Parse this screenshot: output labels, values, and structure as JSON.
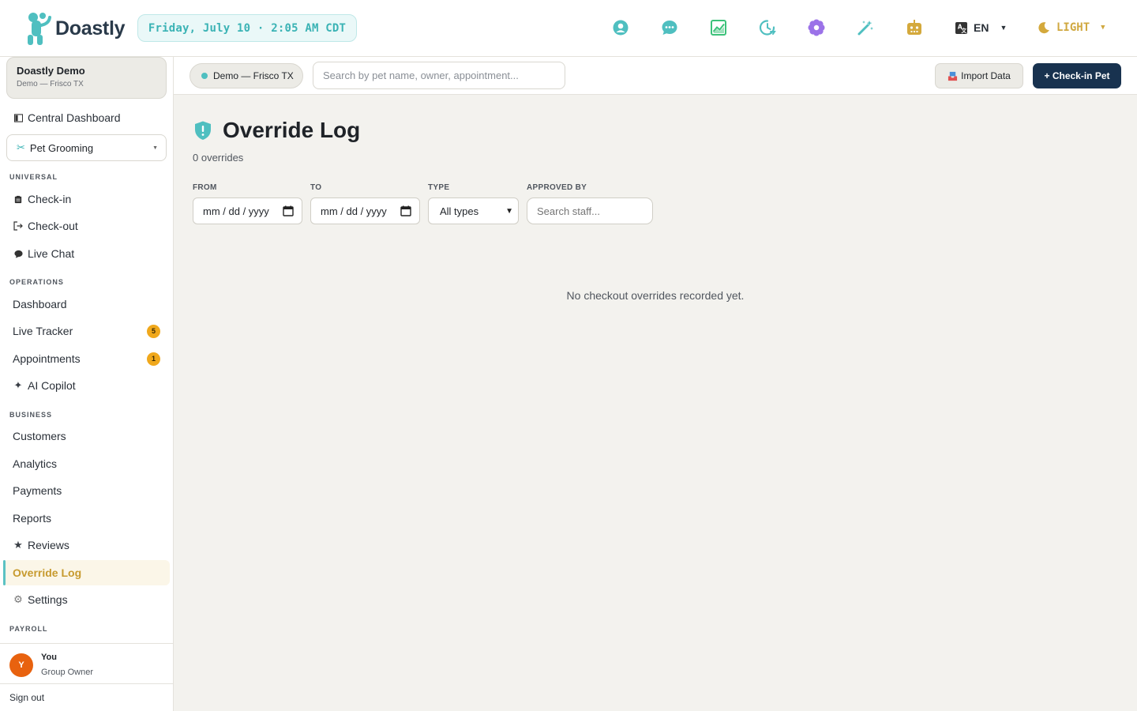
{
  "brand": {
    "name": "Doastly"
  },
  "header": {
    "datetime": "Friday, July 10 · 2:05 AM CDT",
    "language": "EN",
    "theme": "LIGHT",
    "icons": [
      "user-circle-icon",
      "chat-icon",
      "chart-icon",
      "clock-icon",
      "flower-icon",
      "magic-wand-icon",
      "robot-icon"
    ]
  },
  "sidebar": {
    "org": {
      "name": "Doastly Demo",
      "location": "Demo — Frisco TX"
    },
    "central": "Central Dashboard",
    "service": "Pet Grooming",
    "sections": {
      "universal": "UNIVERSAL",
      "operations": "OPERATIONS",
      "business": "BUSINESS",
      "payroll": "PAYROLL"
    },
    "items": {
      "checkin": "Check-in",
      "checkout": "Check-out",
      "livechat": "Live Chat",
      "dashboard": "Dashboard",
      "livetracker": "Live Tracker",
      "livetracker_badge": "5",
      "appointments": "Appointments",
      "appointments_badge": "1",
      "aicopilot": "AI Copilot",
      "customers": "Customers",
      "analytics": "Analytics",
      "payments": "Payments",
      "reports": "Reports",
      "reviews": "Reviews",
      "overridelog": "Override Log",
      "settings": "Settings"
    },
    "user": {
      "initial": "Y",
      "name": "You",
      "role": "Group Owner"
    },
    "signout": "Sign out"
  },
  "subbar": {
    "location": "Demo — Frisco TX",
    "search_placeholder": "Search by pet name, owner, appointment...",
    "import": "Import Data",
    "checkin": "+ Check-in Pet"
  },
  "main": {
    "title": "Override Log",
    "count": "0 overrides",
    "filters": {
      "from_label": "FROM",
      "from_value": "mm / dd / yyyy",
      "to_label": "TO",
      "to_value": "mm / dd / yyyy",
      "type_label": "TYPE",
      "type_value": "All types",
      "approved_label": "APPROVED BY",
      "approved_placeholder": "Search staff..."
    },
    "empty": "No checkout overrides recorded yet."
  },
  "colors": {
    "accent": "#3bb3b5",
    "primary": "#18324f",
    "active": "#c79a2e",
    "badge": "#f0a81c"
  }
}
